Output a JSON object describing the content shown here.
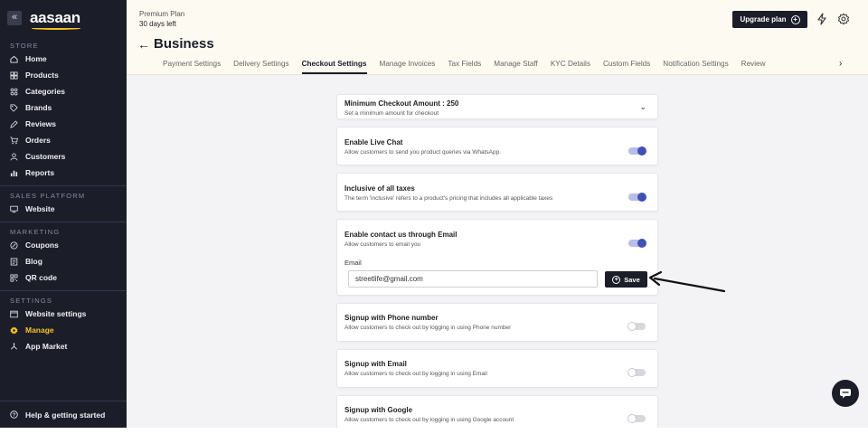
{
  "brand": {
    "name": "aasaan",
    "collapse_icon": "«",
    "accent": "#f5c518"
  },
  "sidebar": {
    "sections": [
      {
        "label": "STORE",
        "items": [
          {
            "label": "Home",
            "icon": "home-icon"
          },
          {
            "label": "Products",
            "icon": "products-icon"
          },
          {
            "label": "Categories",
            "icon": "categories-icon"
          },
          {
            "label": "Brands",
            "icon": "tag-icon"
          },
          {
            "label": "Reviews",
            "icon": "reviews-icon"
          },
          {
            "label": "Orders",
            "icon": "cart-icon"
          },
          {
            "label": "Customers",
            "icon": "customers-icon"
          },
          {
            "label": "Reports",
            "icon": "reports-icon"
          }
        ]
      },
      {
        "label": "SALES PLATFORM",
        "items": [
          {
            "label": "Website",
            "icon": "monitor-icon"
          }
        ]
      },
      {
        "label": "MARKETING",
        "items": [
          {
            "label": "Coupons",
            "icon": "coupon-icon"
          },
          {
            "label": "Blog",
            "icon": "blog-icon"
          },
          {
            "label": "QR code",
            "icon": "qr-icon"
          }
        ]
      },
      {
        "label": "SETTINGS",
        "items": [
          {
            "label": "Website settings",
            "icon": "website-settings-icon"
          },
          {
            "label": "Manage",
            "icon": "gear-icon",
            "active": true
          },
          {
            "label": "App Market",
            "icon": "app-market-icon"
          }
        ]
      }
    ],
    "help": {
      "label": "Help & getting started",
      "icon": "help-icon"
    }
  },
  "header": {
    "plan_name": "Premium Plan",
    "plan_days": "30 days left",
    "upgrade_label": "Upgrade plan",
    "page_title": "Business",
    "tabs": [
      {
        "label": "Payment Settings"
      },
      {
        "label": "Delivery Settings"
      },
      {
        "label": "Checkout Settings",
        "active": true
      },
      {
        "label": "Manage Invoices"
      },
      {
        "label": "Tax Fields"
      },
      {
        "label": "Manage Staff"
      },
      {
        "label": "KYC Details"
      },
      {
        "label": "Custom Fields"
      },
      {
        "label": "Notification Settings"
      },
      {
        "label": "Review"
      }
    ],
    "tabs_more": "›"
  },
  "settings": {
    "min_checkout": {
      "title": "Minimum Checkout Amount : 250",
      "desc": "Set a minimum amount for checkout"
    },
    "live_chat": {
      "title": "Enable Live Chat",
      "desc": "Allow customers to send you product queries via WhatsApp.",
      "enabled": true
    },
    "inclusive_taxes": {
      "title": "Inclusive of all taxes",
      "desc": "The term 'inclusive' refers to a product's pricing that includes all applicable taxes",
      "enabled": true
    },
    "contact_email": {
      "title": "Enable contact us through Email",
      "desc": "Allow customers to email you",
      "enabled": true,
      "email_label": "Email",
      "email_value": "streetlife@gmail.com",
      "save_label": "Save"
    },
    "signup_phone": {
      "title": "Signup with Phone number",
      "desc": "Allow customers to check out by logging in using Phone number",
      "enabled": false
    },
    "signup_email": {
      "title": "Signup with Email",
      "desc": "Allow customers to check out by logging in using Email",
      "enabled": false
    },
    "signup_google": {
      "title": "Signup with Google",
      "desc": "Allow customers to check out by logging in using Google account",
      "enabled": false
    }
  },
  "colors": {
    "sidebar_bg": "#1b1d29",
    "toggle_on": "#3f51b5",
    "header_bg": "#fdfaf1"
  }
}
